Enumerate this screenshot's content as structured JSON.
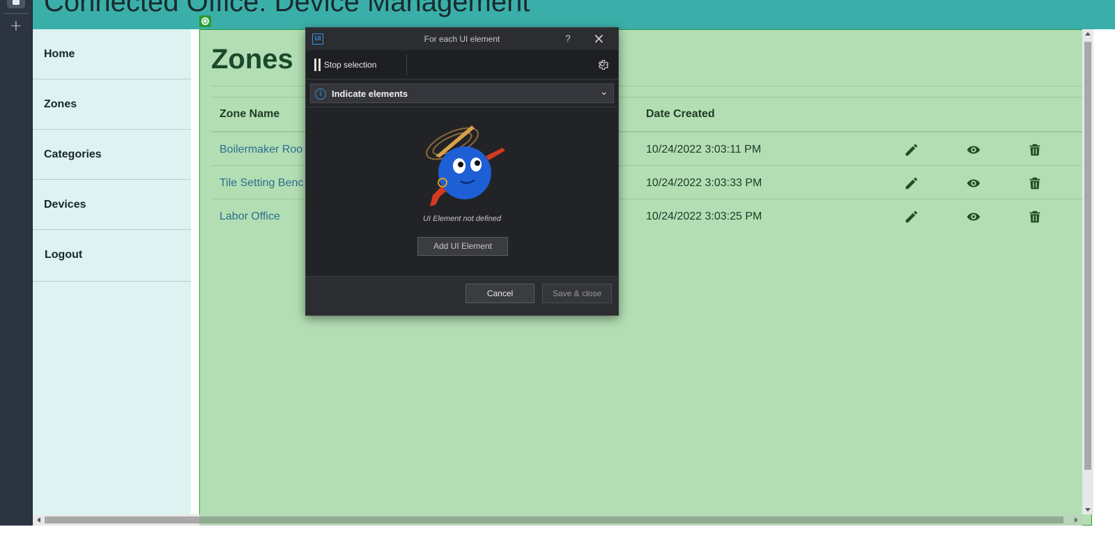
{
  "app": {
    "header_title": "Connected Office: Device Management"
  },
  "rail": {
    "save_icon": "floppy-disk-icon",
    "add_icon": "plus-icon",
    "add_glyph": "+"
  },
  "sidebar": {
    "items": [
      {
        "label": "Home"
      },
      {
        "label": "Zones"
      },
      {
        "label": "Categories"
      },
      {
        "label": "Devices"
      },
      {
        "label": "Logout"
      }
    ]
  },
  "main": {
    "page_title": "Zones",
    "columns": {
      "zone_name": "Zone Name",
      "date_created": "Date Created"
    },
    "rows": [
      {
        "name": "Boilermaker Roo",
        "date": "10/24/2022 3:03:11 PM"
      },
      {
        "name": "Tile Setting Benc",
        "date": "10/24/2022 3:03:33 PM"
      },
      {
        "name": "Labor Office",
        "date": "10/24/2022 3:03:25 PM"
      }
    ],
    "row_actions": [
      "pencil-icon",
      "eye-icon",
      "trash-icon"
    ]
  },
  "dialog": {
    "logo": "UI",
    "title": "For each UI element",
    "help": "?",
    "close": "×",
    "stop_selection": "Stop selection",
    "select_label": "Indicate elements",
    "chevron": "⌄",
    "empty_message": "UI Element not defined",
    "add_button": "Add UI Element",
    "cancel_button": "Cancel",
    "save_button": "Save & close"
  },
  "colors": {
    "header": "#3aafa9",
    "sidebar": "#def2f1",
    "highlight_overlay": "#b3deb4",
    "highlight_border": "#2c9a34",
    "dialog_bg": "#222326",
    "accent_blue": "#3a8fe0"
  }
}
